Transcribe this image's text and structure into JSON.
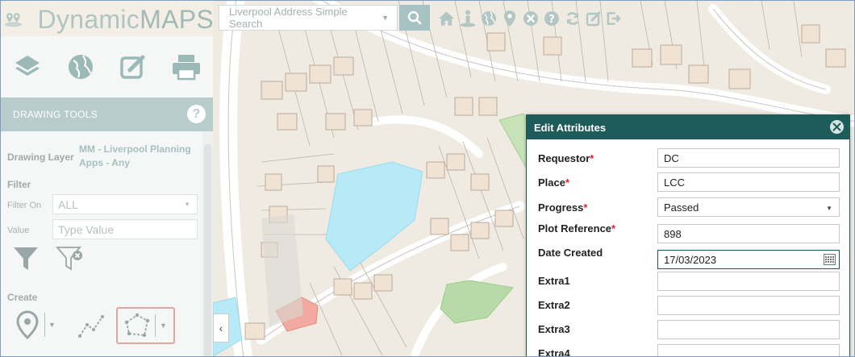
{
  "app": {
    "logo_plain": "Dynamic",
    "logo_bold": "MAPS"
  },
  "search": {
    "placeholder": "Liverpool Address Simple Search"
  },
  "toolbar": {
    "icons": [
      "home-icon",
      "person-pin-icon",
      "globe-icon",
      "map-marker-icon",
      "clear-icon",
      "help-icon",
      "refresh-icon",
      "edit-icon",
      "logout-icon"
    ]
  },
  "sidebar": {
    "icons": [
      "layers-icon",
      "globe-icon",
      "edit-icon",
      "print-icon"
    ],
    "panel_title": "DRAWING TOOLS",
    "drawing_layer_label": "Drawing Layer",
    "drawing_layer_value": "MM - Liverpool Planning Apps - Any",
    "filter_label": "Filter",
    "filter_on_label": "Filter On",
    "filter_on_value": "ALL",
    "value_label": "Value",
    "value_placeholder": "Type Value",
    "create_label": "Create"
  },
  "dialog": {
    "title": "Edit Attributes",
    "fields": [
      {
        "label": "Requestor",
        "required": true,
        "value": "DC"
      },
      {
        "label": "Place",
        "required": true,
        "value": "LCC"
      },
      {
        "label": "Progress",
        "required": true,
        "value": "Passed",
        "dropdown": true
      },
      {
        "label": "Plot Reference",
        "required": true,
        "value": "898"
      },
      {
        "label": "Date Created",
        "required": false,
        "value": "17/03/2023"
      },
      {
        "label": "Extra1",
        "required": false,
        "value": ""
      },
      {
        "label": "Extra2",
        "required": false,
        "value": ""
      },
      {
        "label": "Extra3",
        "required": false,
        "value": ""
      },
      {
        "label": "Extra4",
        "required": false,
        "value": ""
      }
    ],
    "required_mark": "*"
  },
  "colors": {
    "dialog_header": "#1d5c5a",
    "panel_header": "#b7cccb",
    "polygon_blue": "#b7e9f6",
    "polygon_green": "#b8d9a8",
    "polygon_red": "#f2aaa0",
    "required": "#d7262c"
  }
}
